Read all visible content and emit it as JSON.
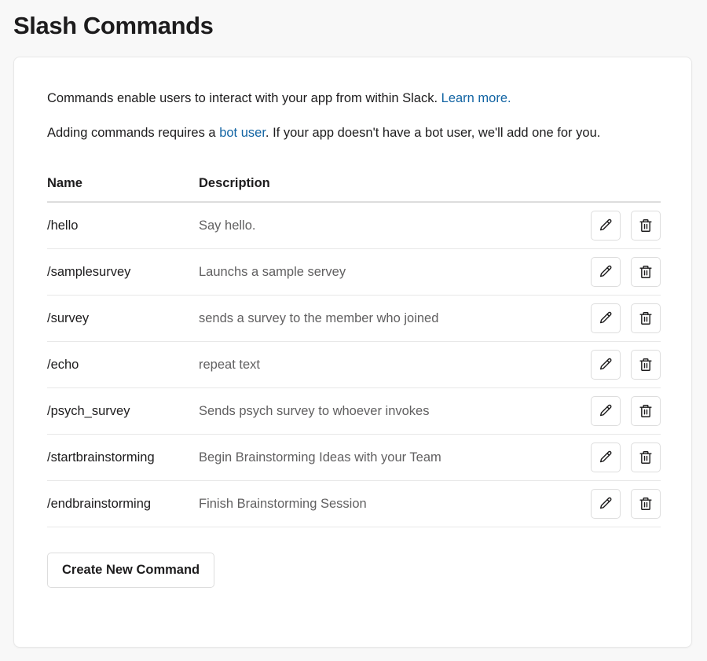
{
  "page_title": "Slash Commands",
  "card": {
    "intro_line1_before": "Commands enable users to interact with your app from within Slack. ",
    "intro_line1_link": "Learn more.",
    "intro_line2_before": "Adding commands requires a ",
    "intro_line2_link": "bot user",
    "intro_line2_after": ". If your app doesn't have a bot user, we'll add one for you."
  },
  "table": {
    "headers": {
      "name": "Name",
      "description": "Description"
    },
    "rows": [
      {
        "name": "/hello",
        "description": "Say hello."
      },
      {
        "name": "/samplesurvey",
        "description": "Launchs a sample servey"
      },
      {
        "name": "/survey",
        "description": "sends a survey to the member who joined"
      },
      {
        "name": "/echo",
        "description": "repeat text"
      },
      {
        "name": "/psych_survey",
        "description": "Sends psych survey to whoever invokes"
      },
      {
        "name": "/startbrainstorming",
        "description": "Begin Brainstorming Ideas with your Team"
      },
      {
        "name": "/endbrainstorming",
        "description": "Finish Brainstorming Session"
      }
    ],
    "row_actions": {
      "edit_icon": "pencil-icon",
      "delete_icon": "trash-icon"
    }
  },
  "create_button_label": "Create New Command",
  "colors": {
    "page_background": "#f8f8f8",
    "card_background": "#ffffff",
    "text_primary": "#1d1c1d",
    "text_secondary": "#616061",
    "link": "#1264a3",
    "border": "#e8e8e8",
    "header_rule": "#dddddd"
  }
}
